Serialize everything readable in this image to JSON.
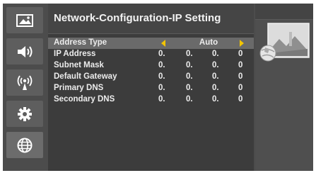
{
  "menu": {
    "title": "Network-Configuration-IP Setting",
    "sidebar": [
      {
        "icon": "picture-icon",
        "active": false
      },
      {
        "icon": "speaker-icon",
        "active": false
      },
      {
        "icon": "broadcast-icon",
        "active": false
      },
      {
        "icon": "gear-icon",
        "active": false
      },
      {
        "icon": "globe-icon",
        "active": true
      }
    ],
    "address_type": {
      "label": "Address Type",
      "value": "Auto"
    },
    "rows": [
      {
        "label": "IP Address",
        "octets": [
          "0.",
          "0.",
          "0.",
          "0"
        ]
      },
      {
        "label": "Subnet Mask",
        "octets": [
          "0.",
          "0.",
          "0.",
          "0"
        ]
      },
      {
        "label": "Default Gateway",
        "octets": [
          "0.",
          "0.",
          "0.",
          "0"
        ]
      },
      {
        "label": "Primary DNS",
        "octets": [
          "0.",
          "0.",
          "0.",
          "0"
        ]
      },
      {
        "label": "Secondary DNS",
        "octets": [
          "0.",
          "0.",
          "0.",
          "0"
        ]
      }
    ]
  },
  "colors": {
    "accent": "#f2c400",
    "background": "#3c3c3c",
    "selected_row": "#6a6a6a"
  }
}
